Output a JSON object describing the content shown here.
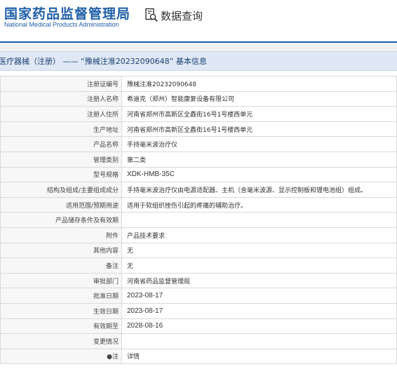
{
  "header": {
    "logo_cn": "国家药品监督管理局",
    "logo_en": "National Medical Products Administration",
    "query_label": "数据查询",
    "query_icon": "search-document-icon"
  },
  "title_bar": {
    "text": "医疗器械（注册） —— “豫械注准20232090648” 基本信息"
  },
  "rows": [
    {
      "label": "注册证编号",
      "value": "豫械注准20232090648"
    },
    {
      "label": "注册人名称",
      "value": "希迪克（郑州）智能康复设备有限公司"
    },
    {
      "label": "注册人住所",
      "value": "河南省郑州市高新区全鑫街16号1号楼西单元"
    },
    {
      "label": "生产地址",
      "value": "河南省郑州市高新区全鑫街16号1号楼西单元"
    },
    {
      "label": "产品名称",
      "value": "手持毫米波治疗仪"
    },
    {
      "label": "管理类别",
      "value": "第二类"
    },
    {
      "label": "型号规格",
      "value": "XDK-HMB-35C"
    },
    {
      "label": "结构及组成/主要组成成分",
      "value": "手持毫米波治疗仪由电源适配器、主机（含毫米波源、显示控制板和锂电池组）组成。"
    },
    {
      "label": "适用范围/预期用途",
      "value": "适用于软组织挫伤引起的疼痛的辅助治疗。"
    },
    {
      "label": "产品储存条件及有效期",
      "value": ""
    },
    {
      "label": "附件",
      "value": "产品技术要求"
    },
    {
      "label": "其他内容",
      "value": "无"
    },
    {
      "label": "备注",
      "value": "无"
    },
    {
      "label": "审批部门",
      "value": "河南省药品监督管理局"
    },
    {
      "label": "批准日期",
      "value": "2023-08-17"
    },
    {
      "label": "生效日期",
      "value": "2023-08-17"
    },
    {
      "label": "有效期至",
      "value": "2028-08-16"
    },
    {
      "label": "变更情况",
      "value": ""
    },
    {
      "label": "●注",
      "value": "详情"
    }
  ],
  "colors": {
    "brand": "#1f5fa8",
    "title_bar_bg": "#dfe8f4",
    "link": "#2a64b0"
  }
}
